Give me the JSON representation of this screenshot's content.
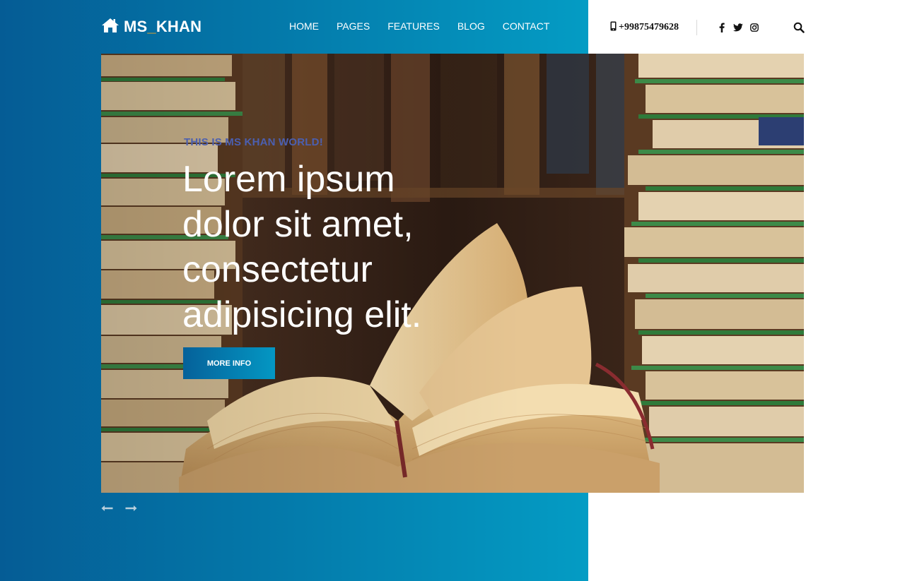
{
  "brand": {
    "logo_prefix": "MS",
    "logo_underscore": "_",
    "logo_suffix": "KHAN",
    "logo_icon": "home-icon"
  },
  "nav": {
    "items": [
      "HOME",
      "PAGES",
      "FEATURES",
      "BLOG",
      "CONTACT"
    ]
  },
  "contact": {
    "phone": "+99875479628",
    "phone_icon": "mobile-icon"
  },
  "social": {
    "icons": [
      "facebook-icon",
      "twitter-icon",
      "instagram-icon"
    ]
  },
  "search": {
    "icon": "search-icon"
  },
  "hero": {
    "kicker": "THIS IS MS KHAN WORLD!",
    "headline_lines": [
      "Lorem ipsum",
      "dolor sit amet,",
      "consectetur",
      "adipisicing elit."
    ],
    "button": "MORE INFO",
    "prev_icon": "arrow-left-icon",
    "next_icon": "arrow-right-icon"
  },
  "colors": {
    "gradient_start": "#055c95",
    "gradient_end": "#049cc4",
    "logo_accent": "#f5a623",
    "kicker": "#4b5fb0"
  }
}
